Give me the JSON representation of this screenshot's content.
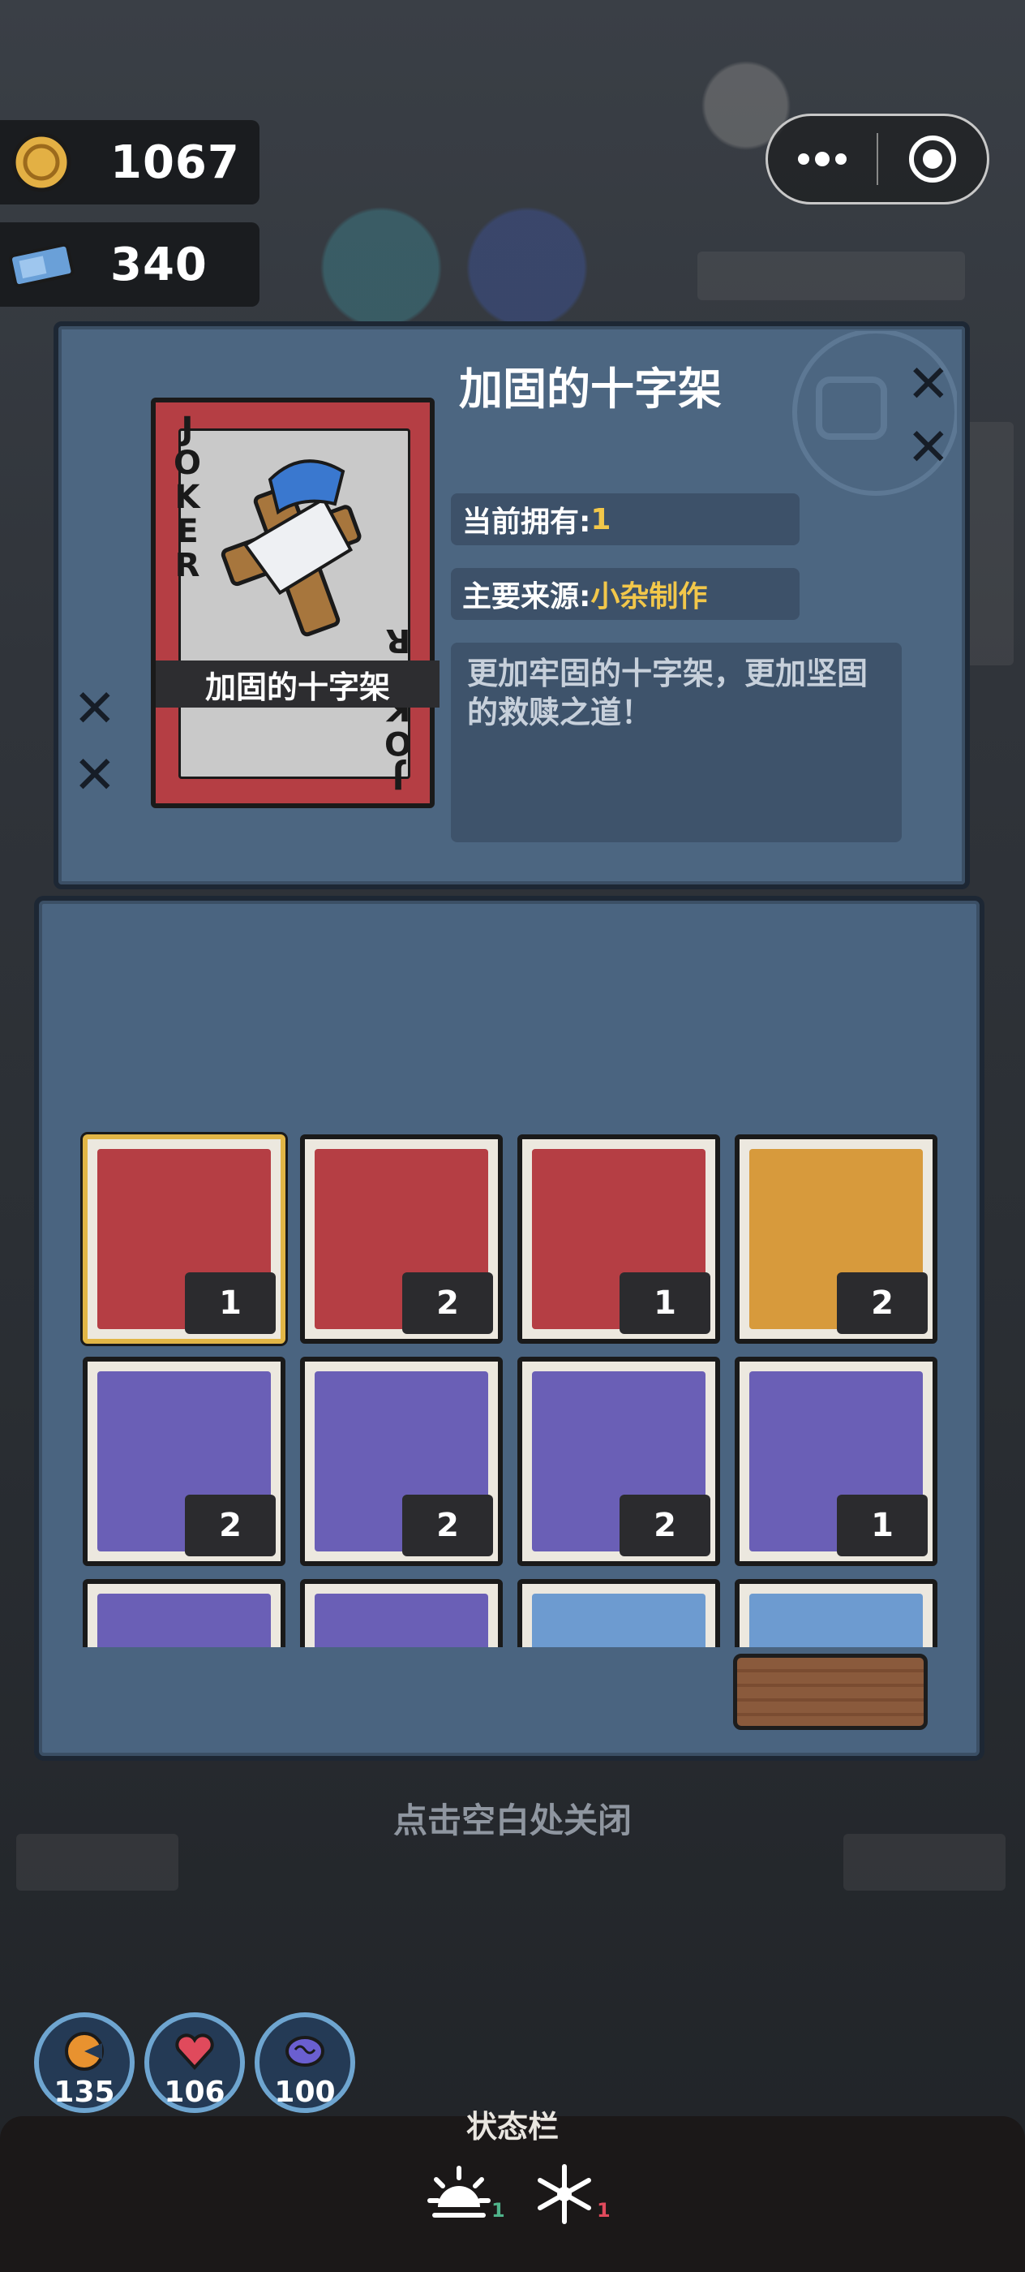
{
  "currency": {
    "coins": "1067",
    "tickets": "340"
  },
  "capsule": {
    "more_icon": "more-dots-icon",
    "close_icon": "target-circle-icon"
  },
  "item": {
    "card_corner_text": "JOKER",
    "card_name": "加固的十字架",
    "title": "加固的十字架",
    "owned_label": "当前拥有:",
    "owned_value": "1",
    "source_label": "主要来源:",
    "source_value": "小杂制作",
    "description": "更加牢固的十字架，更加坚固的救赎之道！"
  },
  "inventory": [
    {
      "name": "reinforced-cross",
      "count": "1",
      "color": "red",
      "selected": true
    },
    {
      "name": "gold-badge",
      "count": "2",
      "color": "red"
    },
    {
      "name": "wooden-cross",
      "count": "1",
      "color": "red"
    },
    {
      "name": "steak-meal",
      "count": "2",
      "color": "orange"
    },
    {
      "name": "toy-ticket",
      "count": "2",
      "color": "purple"
    },
    {
      "name": "sunglasses-book",
      "count": "2",
      "color": "purple"
    },
    {
      "name": "first-aid-kit",
      "count": "2",
      "color": "purple"
    },
    {
      "name": "vaccine-box",
      "count": "1",
      "color": "purple"
    },
    {
      "name": "item-9",
      "count": "",
      "color": "purple"
    },
    {
      "name": "item-10",
      "count": "",
      "color": "purple"
    },
    {
      "name": "item-11",
      "count": "",
      "color": "blue"
    },
    {
      "name": "item-12",
      "count": "",
      "color": "blue"
    }
  ],
  "close_hint": "点击空白处关闭",
  "stats": {
    "hunger": "135",
    "health": "106",
    "sanity": "100"
  },
  "status_bar": {
    "title": "状态栏",
    "sun_count": "1",
    "snow_count": "1"
  }
}
